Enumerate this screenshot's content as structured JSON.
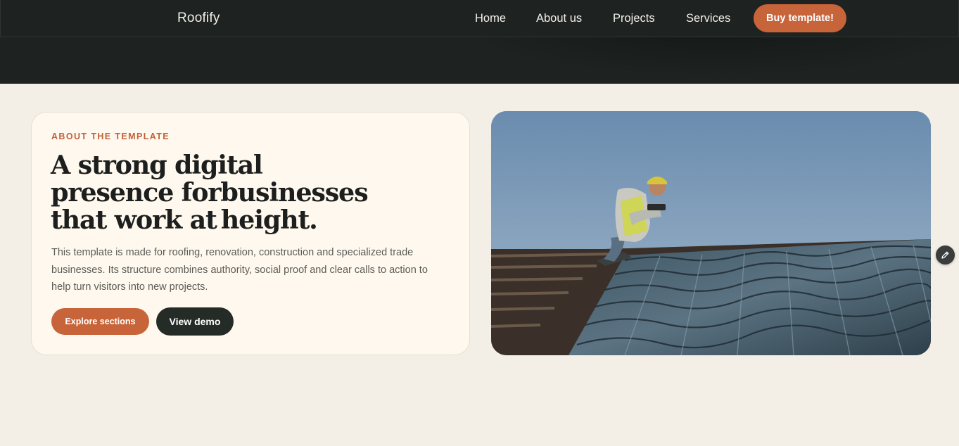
{
  "nav": {
    "brand": "Roofify",
    "links": [
      "Home",
      "About us",
      "Projects",
      "Services"
    ],
    "cta": "Buy template!"
  },
  "hero": {
    "eyebrow": "ABOUT THE TEMPLATE",
    "title_lines": [
      "A strong digital",
      "presence forbusinesses",
      "that work at height."
    ],
    "body": "This template is made for roofing, renovation, construction and specialized trade businesses. Its structure combines authority, social proof and clear calls to action to help turn visitors into new projects.",
    "primary_button": "Explore sections",
    "secondary_button": "View demo"
  },
  "image": {
    "subject": "roofer-on-roof-photo"
  },
  "icons": {
    "edit": "pencil-icon"
  },
  "colors": {
    "accent": "#c8643a",
    "dark": "#1e2321",
    "background": "#f3efe7",
    "card": "#fff8ee"
  }
}
